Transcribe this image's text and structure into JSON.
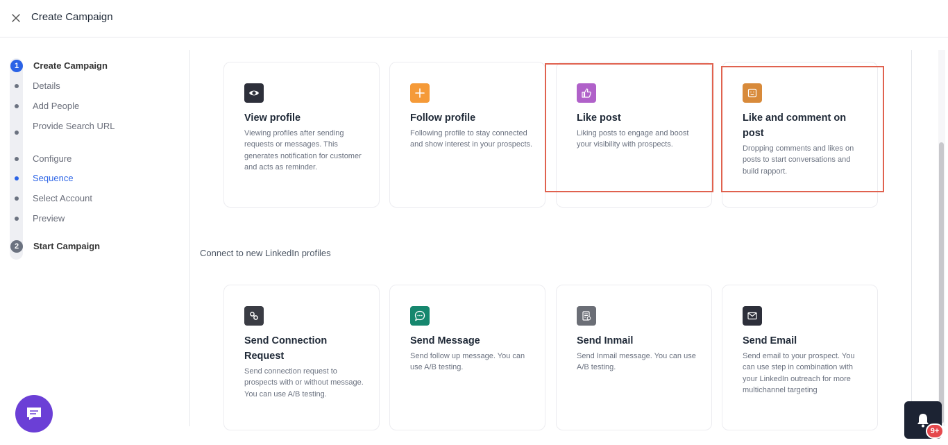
{
  "header": {
    "title": "Create Campaign",
    "close_icon": "close-icon"
  },
  "sidebar": {
    "step1": {
      "number": "1",
      "label": "Create Campaign"
    },
    "items": [
      {
        "label": "Details",
        "active": false
      },
      {
        "label": "Add People",
        "active": false
      },
      {
        "label": "Provide Search URL",
        "active": false
      },
      {
        "label": "Configure",
        "active": false
      },
      {
        "label": "Sequence",
        "active": true
      },
      {
        "label": "Select Account",
        "active": false
      },
      {
        "label": "Preview",
        "active": false
      }
    ],
    "step2": {
      "number": "2",
      "label": "Start Campaign"
    }
  },
  "cards_row1": [
    {
      "icon": "eye-icon",
      "icon_color": "#2d2f3a",
      "title": "View profile",
      "desc": "Viewing profiles after sending requests or messages. This generates notification for customer and acts as reminder."
    },
    {
      "icon": "plus-icon",
      "icon_color": "#f59a38",
      "title": "Follow profile",
      "desc": "Following profile to stay connected and show interest in your prospects."
    },
    {
      "icon": "thumbs-up-icon",
      "icon_color": "#b061c9",
      "title": "Like post",
      "desc": "Liking posts to engage and boost your visibility with prospects."
    },
    {
      "icon": "comment-face-icon",
      "icon_color": "#d88a3a",
      "title": "Like and comment on post",
      "desc": "Dropping comments and likes on posts to start conversations and build rapport."
    }
  ],
  "section": {
    "label": "Connect to new LinkedIn profiles"
  },
  "cards_row2": [
    {
      "icon": "link-icon",
      "icon_color": "#3a3c44",
      "title": "Send Connection Request",
      "desc": "Send connection request to prospects with or without message. You can use A/B testing."
    },
    {
      "icon": "message-icon",
      "icon_color": "#16876e",
      "title": "Send Message",
      "desc": "Send follow up message. You can use A/B testing."
    },
    {
      "icon": "inmail-icon",
      "icon_color": "#6b6e76",
      "title": "Send Inmail",
      "desc": "Send Inmail message. You can use A/B testing."
    },
    {
      "icon": "envelope-icon",
      "icon_color": "#2d2f3a",
      "title": "Send Email",
      "desc": "Send email to your prospect. You can use step in combination with your LinkedIn outreach for more multichannel targeting"
    }
  ],
  "notifications": {
    "badge": "9+"
  },
  "colors": {
    "accent": "#2b63e6",
    "highlight": "#e0624f",
    "chat": "#6b3fd6"
  }
}
